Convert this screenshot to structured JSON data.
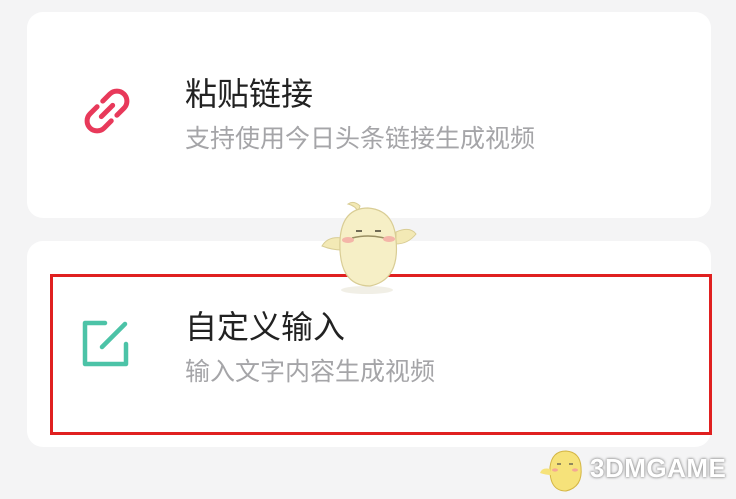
{
  "options": [
    {
      "title": "粘贴链接",
      "subtitle": "支持使用今日头条链接生成视频",
      "icon": "link-icon",
      "icon_color": "#e8395a"
    },
    {
      "title": "自定义输入",
      "subtitle": "输入文字内容生成视频",
      "icon": "edit-icon",
      "icon_color": "#4cc3a7"
    }
  ],
  "highlight_color": "#e02020",
  "watermark": {
    "text": "3DMGAME",
    "icon": "mascot-icon"
  }
}
